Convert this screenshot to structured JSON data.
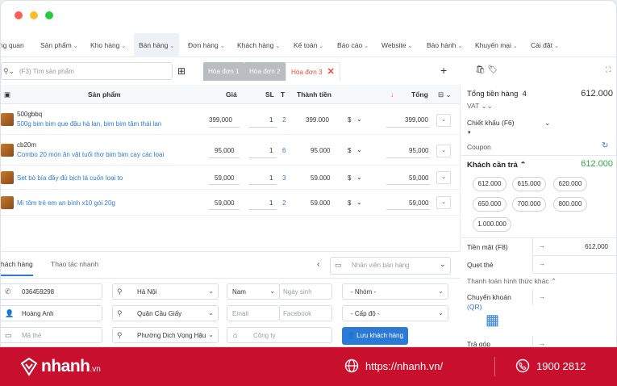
{
  "nav": {
    "items": [
      {
        "label": "ng quan",
        "caret": false
      },
      {
        "label": "Sản phẩm",
        "caret": true
      },
      {
        "label": "Kho hàng",
        "caret": true
      },
      {
        "label": "Bán hàng",
        "caret": true
      },
      {
        "label": "Đơn hàng",
        "caret": true
      },
      {
        "label": "Khách hàng",
        "caret": true
      },
      {
        "label": "Kế toán",
        "caret": true
      },
      {
        "label": "Báo cáo",
        "caret": true
      },
      {
        "label": "Website",
        "caret": true
      },
      {
        "label": "Bảo hành",
        "caret": true
      },
      {
        "label": "Khuyến mại",
        "caret": true
      },
      {
        "label": "Cài đặt",
        "caret": true
      }
    ]
  },
  "search": {
    "placeholder": "(F3) Tìm sản phẩm"
  },
  "tabs": [
    {
      "label": "Hóa đơn 1"
    },
    {
      "label": "Hóa đơn 2"
    },
    {
      "label": "Hóa đơn 3",
      "close": "✕"
    }
  ],
  "table": {
    "headers": {
      "product": "Sản phẩm",
      "price": "Giá",
      "qty": "SL",
      "t": "T",
      "amount": "Thành tiền",
      "total": "Tổng"
    },
    "rows": [
      {
        "code": "500gbbq",
        "name": "500g bim bim que đậu hà lan, bim bim tăm thái lan",
        "price": "399,000",
        "qty": "1",
        "t": "2",
        "amount": "399.000",
        "discount": "$",
        "total": "399,000"
      },
      {
        "code": "cb20m",
        "name": "Combo 20 món ăn vặt tuổi thơ bim bim cay các loại",
        "price": "95,000",
        "qty": "1",
        "t": "6",
        "amount": "95.000",
        "discount": "$",
        "total": "95,000"
      },
      {
        "code": "",
        "name": "Set bò bía đầy đủ bịch lá cuốn loại to",
        "price": "59,000",
        "qty": "1",
        "t": "3",
        "amount": "59.000",
        "discount": "$",
        "total": "59,000"
      },
      {
        "code": "",
        "name": "Mì tôm trẻ em an bình x10 gói 20g",
        "price": "59,000",
        "qty": "1",
        "t": "2",
        "amount": "59.000",
        "discount": "$",
        "total": "59,000"
      }
    ]
  },
  "customer": {
    "tabs": {
      "customer": "hách hàng",
      "quick": "Thao tác nhanh"
    },
    "staff_placeholder": "Nhân viên bán hàng",
    "phone": "036459298",
    "name": "Hoàng Anh",
    "card_placeholder": "Mã thẻ",
    "city": "Hà Nội",
    "district": "Quận Cầu Giấy",
    "ward": "Phường Dịch Vọng Hậu",
    "gender": "Nam",
    "dob_placeholder": "Ngày sinh",
    "email_placeholder": "Email",
    "facebook_placeholder": "Facebook",
    "company_placeholder": "Công ty",
    "group": "- Nhóm -",
    "level": "- Cấp độ -",
    "save_button": "Lưu khách hàng"
  },
  "summary": {
    "total_label": "Tổng tiền hàng",
    "total_count": "4",
    "total_value": "612.000",
    "vat_label": "VAT",
    "discount_label": "Chiết khấu (F6)",
    "coupon_label": "Coupon",
    "pay_label": "Khách cần trả",
    "pay_value": "612.000",
    "chips": [
      "612.000",
      "615.000",
      "620.000",
      "650.000",
      "700.000",
      "800.000",
      "1.000.000"
    ],
    "cash_label": "Tiền mặt (F8)",
    "cash_value": "612,000",
    "card_label": "Quẹt thẻ",
    "payment_methods_label": "Thanh toán hình thức khác",
    "transfer_label": "Chuyển khoản",
    "qr_label": "(QR)",
    "installment_label": "Trả góp"
  },
  "footer": {
    "brand": "nhanh",
    "brand_suffix": ".vn",
    "url": "https://nhanh.vn/",
    "phone": "1900 2812"
  },
  "colors": {
    "accent": "#2b7bd6",
    "brand_red": "#c8102e",
    "active_tab": "#e74b3c",
    "pay_green": "#2ea84a"
  }
}
